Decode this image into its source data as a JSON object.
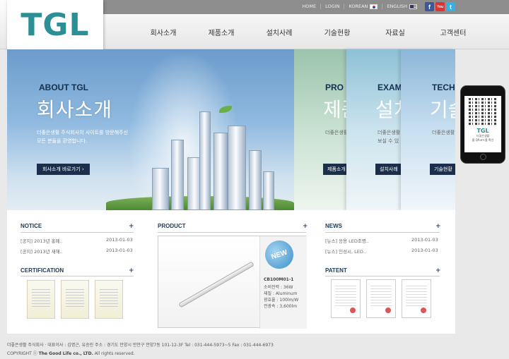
{
  "header": {
    "logo": "TGL",
    "top_links": [
      "HOME",
      "LOGIN",
      "KOREAN",
      "ENGLISH"
    ],
    "social": [
      "f",
      "You",
      "t"
    ],
    "nav": [
      "회사소개",
      "제품소개",
      "설치사례",
      "기술현황",
      "자료실",
      "고객센터"
    ]
  },
  "banner": {
    "en_title": "ABOUT TGL",
    "ko_title": "회사소개",
    "desc_line1": "더좋은생활 주식회사의 사이트를 방문해주신",
    "desc_line2": "모든 분들을 환영합니다.",
    "button": "회사소개 바로가기 ›"
  },
  "panels": [
    {
      "en": "PRO",
      "ko": "제품",
      "desc": "더좋은생활",
      "btn": "제품소개"
    },
    {
      "en": "EXAM",
      "ko": "설치",
      "desc": "더좋은생활\n보실 수 있",
      "btn": "설치사례"
    },
    {
      "en": "TECH",
      "ko": "기술",
      "desc": "더좋은생활",
      "btn": "기술현황"
    }
  ],
  "phone": {
    "brand": "TGL",
    "caption": "더좋은생활",
    "note": "를 QR코드를 확인"
  },
  "notice": {
    "title": "NOTICE",
    "rows": [
      {
        "text": "[공지] 2013년 홍페..",
        "date": "2013-01-03"
      },
      {
        "text": "[공지] 2013년 새해..",
        "date": "2013-01-03"
      }
    ]
  },
  "certification": {
    "title": "CERTIFICATION"
  },
  "product": {
    "title": "PRODUCT",
    "badge": "NEW",
    "model": "CB100M01-1",
    "specs": [
      "소비전력 : 36W",
      "재질 : Aluminum",
      "광효율 : 100lm/W",
      "전광속 : 3,600lm"
    ]
  },
  "news": {
    "title": "NEWS",
    "rows": [
      {
        "text": "[뉴스] 응용 LED조명..",
        "date": "2013-01-03"
      },
      {
        "text": "[뉴스] 인성시, LED..",
        "date": "2013-01-03"
      }
    ]
  },
  "patent": {
    "title": "PATENT"
  },
  "footer": {
    "info": "더좋은생활 주식회사 · 대표이사 : 김명근, 유승민   주소 : 경기도 안양시 만안구 안양7동 101-12-3F     Tel : 031-444-5973~5     Fax : 031-444-6973",
    "copyright_prefix": "COPYRIGHT ⓒ ",
    "company": "The Good Life co., LTD.",
    "copyright_suffix": " All rights reserved."
  }
}
